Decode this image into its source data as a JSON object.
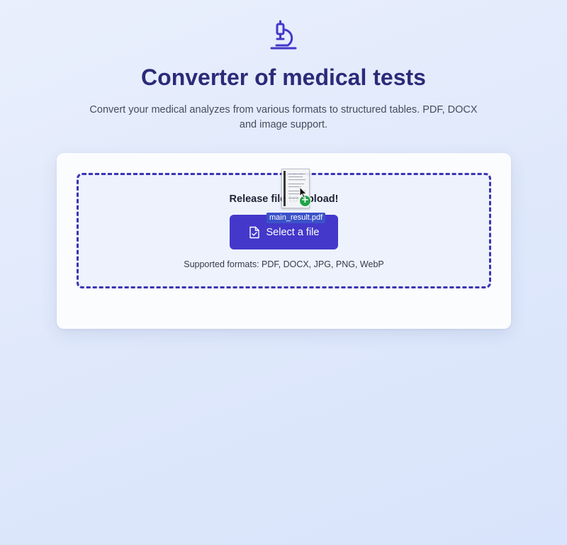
{
  "header": {
    "logo_icon": "microscope-icon",
    "title": "Converter of medical tests",
    "subtitle": "Convert your medical analyzes from various formats to structured tables. PDF, DOCX and image support."
  },
  "upload": {
    "drop_label": "Release file to upload!",
    "select_button_label": "Select a file",
    "select_button_icon": "file-check-icon",
    "formats": "Supported formats: PDF, DOCX, JPG, PNG, WebP"
  },
  "drag": {
    "file_name": "main_result.pdf",
    "icon": "document-thumbnail-icon",
    "badge_icon": "plus-badge-icon"
  },
  "colors": {
    "accent": "#4338ca",
    "title": "#2b2b78",
    "dashed_border": "#3a34b3",
    "badge": "#21a34a"
  }
}
